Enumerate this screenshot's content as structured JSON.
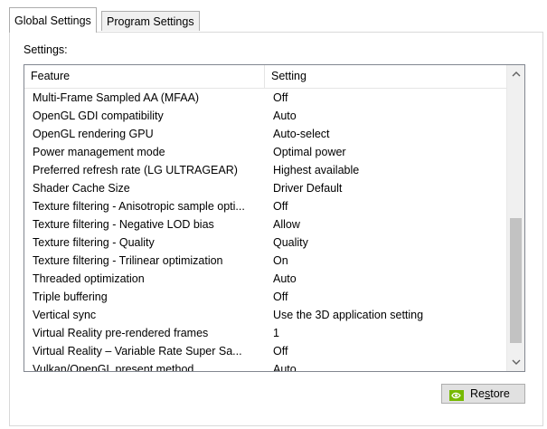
{
  "tabs": [
    {
      "label": "Global Settings",
      "active": true
    },
    {
      "label": "Program Settings",
      "active": false
    }
  ],
  "settings_label": "Settings:",
  "list": {
    "columns": [
      "Feature",
      "Setting"
    ],
    "rows": [
      {
        "feature": "Multi-Frame Sampled AA (MFAA)",
        "setting": "Off"
      },
      {
        "feature": "OpenGL GDI compatibility",
        "setting": "Auto"
      },
      {
        "feature": "OpenGL rendering GPU",
        "setting": "Auto-select"
      },
      {
        "feature": "Power management mode",
        "setting": "Optimal power"
      },
      {
        "feature": "Preferred refresh rate (LG ULTRAGEAR)",
        "setting": "Highest available"
      },
      {
        "feature": "Shader Cache Size",
        "setting": "Driver Default"
      },
      {
        "feature": "Texture filtering - Anisotropic sample opti...",
        "setting": "Off"
      },
      {
        "feature": "Texture filtering - Negative LOD bias",
        "setting": "Allow"
      },
      {
        "feature": "Texture filtering - Quality",
        "setting": "Quality"
      },
      {
        "feature": "Texture filtering - Trilinear optimization",
        "setting": "On"
      },
      {
        "feature": "Threaded optimization",
        "setting": "Auto"
      },
      {
        "feature": "Triple buffering",
        "setting": "Off"
      },
      {
        "feature": "Vertical sync",
        "setting": "Use the 3D application setting"
      },
      {
        "feature": "Virtual Reality pre-rendered frames",
        "setting": "1"
      },
      {
        "feature": "Virtual Reality – Variable Rate Super Sa...",
        "setting": "Off"
      },
      {
        "feature": "Vulkan/OpenGL present method",
        "setting": "Auto"
      }
    ]
  },
  "scrollbar": {
    "up_icon": "chevron-up-icon",
    "down_icon": "chevron-down-icon"
  },
  "restore_button": {
    "label_pre": "Re",
    "label_underlined": "s",
    "label_post": "tore",
    "icon": "nvidia-icon"
  },
  "colors": {
    "nvidia_green": "#76b900",
    "button_face": "#e1e1e1"
  }
}
